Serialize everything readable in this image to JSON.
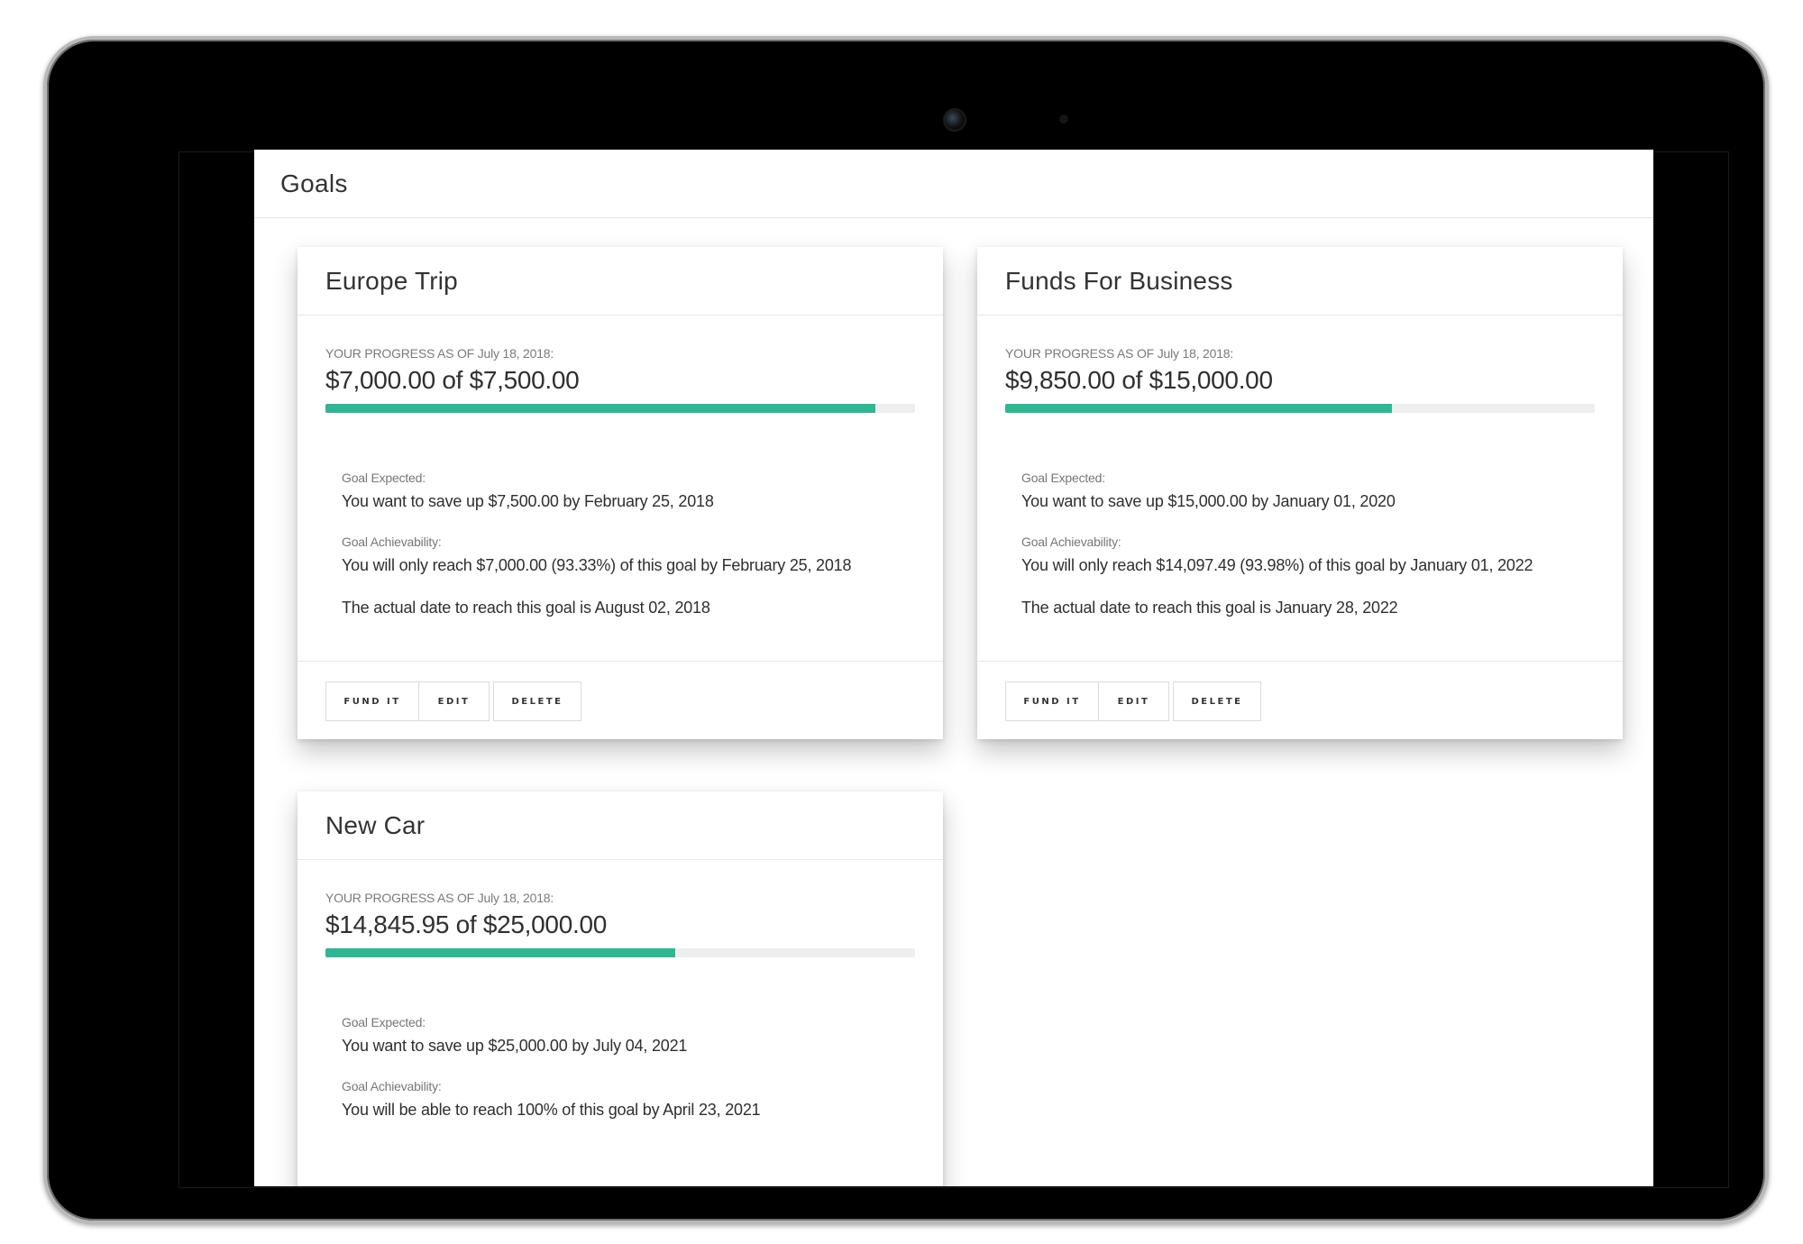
{
  "page": {
    "title": "Goals"
  },
  "goals": [
    {
      "name": "Europe Trip",
      "progress_label": "YOUR PROGRESS AS OF July 18, 2018:",
      "amount": "$7,000.00 of $7,500.00",
      "progress_percent": 93.33,
      "expected_label": "Goal Expected:",
      "expected_text": "You want to save up $7,500.00 by February 25, 2018",
      "achievability_label": "Goal Achievability:",
      "achievability_text": "You will only reach $7,000.00 (93.33%) of this goal by February 25, 2018",
      "actual_date_text": "The actual date to reach this goal is August 02, 2018",
      "buttons": {
        "fund": "FUND IT",
        "edit": "EDIT",
        "delete": "DELETE"
      }
    },
    {
      "name": "Funds For Business",
      "progress_label": "YOUR PROGRESS AS OF July 18, 2018:",
      "amount": "$9,850.00 of $15,000.00",
      "progress_percent": 65.67,
      "expected_label": "Goal Expected:",
      "expected_text": "You want to save up $15,000.00 by January 01, 2020",
      "achievability_label": "Goal Achievability:",
      "achievability_text": "You will only reach $14,097.49 (93.98%) of this goal by January 01, 2022",
      "actual_date_text": "The actual date to reach this goal is January 28, 2022",
      "buttons": {
        "fund": "FUND IT",
        "edit": "EDIT",
        "delete": "DELETE"
      }
    },
    {
      "name": "New Car",
      "progress_label": "YOUR PROGRESS AS OF July 18, 2018:",
      "amount": "$14,845.95 of $25,000.00",
      "progress_percent": 59.38,
      "expected_label": "Goal Expected:",
      "expected_text": "You want to save up $25,000.00 by July 04, 2021",
      "achievability_label": "Goal Achievability:",
      "achievability_text": "You will be able to reach 100% of this goal by April 23, 2021"
    }
  ],
  "colors": {
    "progress_fill": "#2fb793",
    "progress_track": "#eeeeee",
    "device_frame": "#000000"
  }
}
